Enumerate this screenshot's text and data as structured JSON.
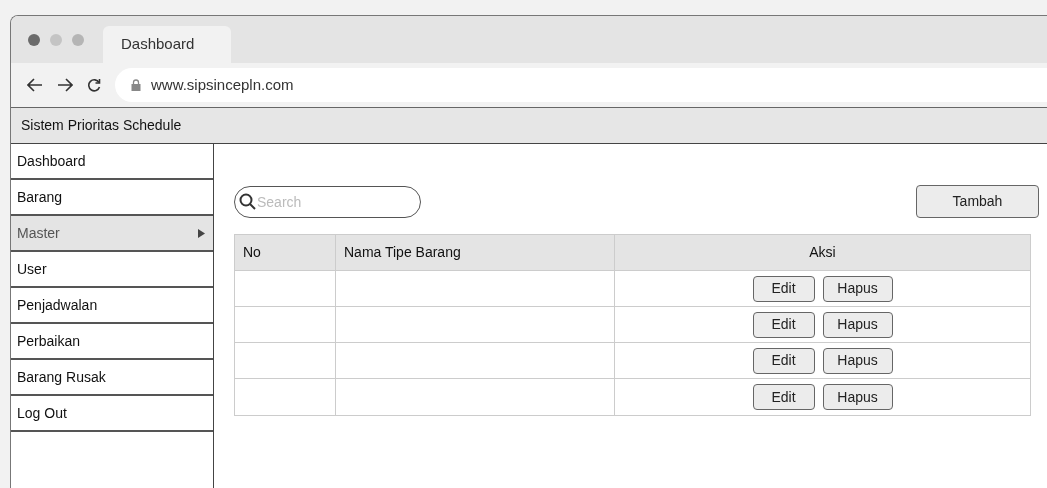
{
  "browser": {
    "tab": "Dashboard",
    "url": "www.sipsincepln.com"
  },
  "app_title": "Sistem Prioritas Schedule",
  "sidebar": {
    "items": [
      {
        "label": "Dashboard",
        "selected": false,
        "has_submenu": false
      },
      {
        "label": "Barang",
        "selected": false,
        "has_submenu": false
      },
      {
        "label": "Master",
        "selected": true,
        "has_submenu": true
      },
      {
        "label": "User",
        "selected": false,
        "has_submenu": false
      },
      {
        "label": "Penjadwalan",
        "selected": false,
        "has_submenu": false
      },
      {
        "label": "Perbaikan",
        "selected": false,
        "has_submenu": false
      },
      {
        "label": "Barang Rusak",
        "selected": false,
        "has_submenu": false
      },
      {
        "label": "Log Out",
        "selected": false,
        "has_submenu": false
      }
    ]
  },
  "search": {
    "placeholder": "Search"
  },
  "add_button": "Tambah",
  "table": {
    "columns": [
      "No",
      "Nama Tipe Barang",
      "Aksi"
    ],
    "rows": [
      {
        "actions": [
          "Edit",
          "Hapus"
        ]
      },
      {
        "actions": [
          "Edit",
          "Hapus"
        ]
      },
      {
        "actions": [
          "Edit",
          "Hapus"
        ]
      },
      {
        "actions": [
          "Edit",
          "Hapus"
        ]
      }
    ]
  }
}
